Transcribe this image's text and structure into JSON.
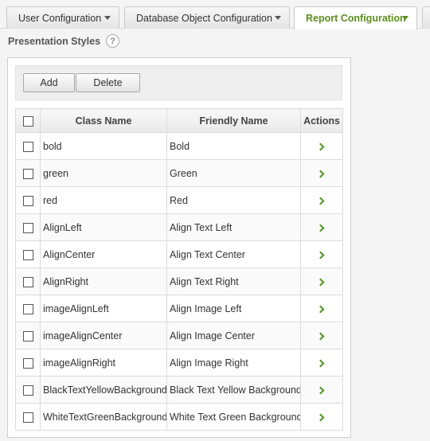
{
  "tabs": [
    {
      "label": "User Configuration",
      "active": false
    },
    {
      "label": "Database Object Configuration",
      "active": false
    },
    {
      "label": "Report Configuration",
      "active": true
    }
  ],
  "section": {
    "title": "Presentation Styles",
    "help": "?"
  },
  "toolbar": {
    "add_label": "Add",
    "delete_label": "Delete"
  },
  "table": {
    "headers": {
      "class_name": "Class Name",
      "friendly_name": "Friendly Name",
      "actions": "Actions"
    },
    "rows": [
      {
        "class_name": "bold",
        "friendly_name": "Bold"
      },
      {
        "class_name": "green",
        "friendly_name": "Green"
      },
      {
        "class_name": "red",
        "friendly_name": "Red"
      },
      {
        "class_name": "AlignLeft",
        "friendly_name": "Align Text Left"
      },
      {
        "class_name": "AlignCenter",
        "friendly_name": "Align Text Center"
      },
      {
        "class_name": "AlignRight",
        "friendly_name": "Align Text Right"
      },
      {
        "class_name": "imageAlignLeft",
        "friendly_name": "Align Image Left"
      },
      {
        "class_name": "imageAlignCenter",
        "friendly_name": "Align Image Center"
      },
      {
        "class_name": "imageAlignRight",
        "friendly_name": "Align Image Right"
      },
      {
        "class_name": "BlackTextYellowBackground",
        "friendly_name": "Black Text Yellow Background"
      },
      {
        "class_name": "WhiteTextGreenBackground",
        "friendly_name": "White Text Green Background"
      }
    ]
  },
  "colors": {
    "accent": "#5a8f1c",
    "action_arrow": "#4a9a1a"
  }
}
